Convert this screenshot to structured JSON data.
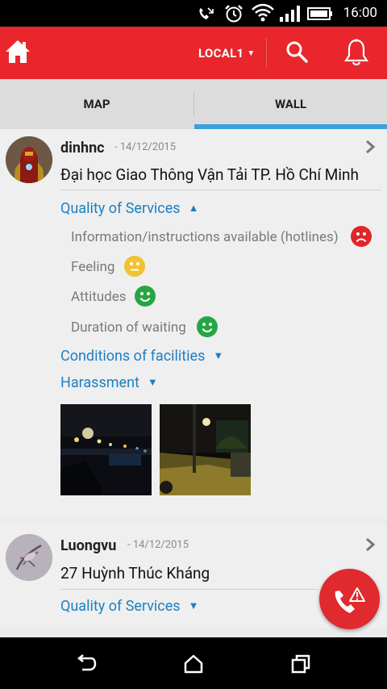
{
  "status_bar": {
    "time": "16:00"
  },
  "app_bar": {
    "location_label": "LOCAL1",
    "location_caret": "▼"
  },
  "tabs": [
    {
      "label": "MAP"
    },
    {
      "label": "WALL"
    }
  ],
  "posts": [
    {
      "username": "dinhnc",
      "date": "- 14/12/2015",
      "place": "Đại học Giao Thông Vận Tải TP. Hồ Chí Minh",
      "sections": [
        {
          "title": "Quality of Services",
          "arrow": "▲"
        },
        {
          "title": "Conditions of facilities",
          "arrow": "▼"
        },
        {
          "title": "Harassment",
          "arrow": "▼"
        }
      ],
      "ratings": [
        {
          "label": "Information/instructions available (hotlines)",
          "mood": "sad",
          "color": "#e0262b"
        },
        {
          "label": "Feeling",
          "mood": "neutral",
          "color": "#f2c230"
        },
        {
          "label": "Attitudes",
          "mood": "happy",
          "color": "#25a645"
        },
        {
          "label": "Duration of waiting",
          "mood": "happy",
          "color": "#25a645"
        }
      ]
    },
    {
      "username": "Luongvu",
      "date": "- 14/12/2015",
      "place": "27 Huỳnh Thúc Kháng",
      "sections": [
        {
          "title": "Quality of Services",
          "arrow": "▼"
        }
      ]
    }
  ],
  "colors": {
    "brand_red": "#e8262b",
    "tab_indicator": "#3ba0dc",
    "link_blue": "#1b7fc4"
  }
}
